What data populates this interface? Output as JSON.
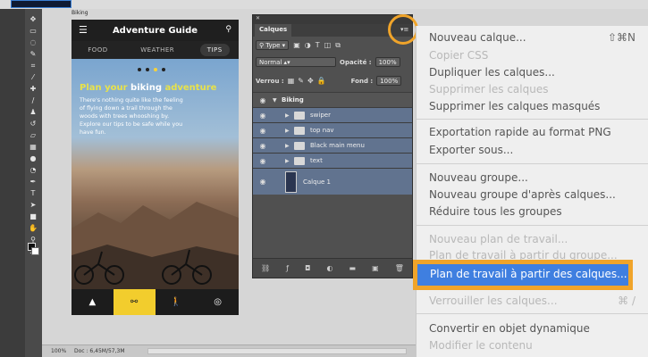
{
  "document": {
    "label": "Biking"
  },
  "app": {
    "title": "Adventure Guide",
    "tabs": [
      "FOOD",
      "WEATHER",
      "TIPS"
    ],
    "hero_title_accent": "Plan your ",
    "hero_title_mid": "biking",
    "hero_title_end": " adventure",
    "hero_body": "There's nothing quite like the feeling of flying down a trail through the woods with trees whooshing by. Explore our tips to be safe while you have fun."
  },
  "layers_panel": {
    "tab_label": "Calques",
    "filter": "Type",
    "blend_mode": "Normal",
    "opacity_label": "Opacité :",
    "opacity_value": "100%",
    "lock_label": "Verrou :",
    "fill_label": "Fond :",
    "fill_value": "100%",
    "items": [
      {
        "name": "Biking"
      },
      {
        "name": "swiper"
      },
      {
        "name": "top nav"
      },
      {
        "name": "Black main menu"
      },
      {
        "name": "text"
      },
      {
        "name": "Calque 1"
      }
    ]
  },
  "context_menu": {
    "items": [
      {
        "label": "Nouveau calque...",
        "shortcut": "⇧⌘N"
      },
      {
        "label": "Copier CSS"
      },
      {
        "label": "Dupliquer les calques..."
      },
      {
        "label": "Supprimer les calques"
      },
      {
        "label": "Supprimer les calques masqués"
      },
      {
        "label": "Exportation rapide au format PNG"
      },
      {
        "label": "Exporter sous..."
      },
      {
        "label": "Nouveau groupe..."
      },
      {
        "label": "Nouveau groupe d'après calques..."
      },
      {
        "label": "Réduire tous les groupes"
      },
      {
        "label": "Nouveau plan de travail..."
      },
      {
        "label": "Plan de travail à partir du groupe..."
      },
      {
        "label": "Plan de travail à partir des calques..."
      },
      {
        "label": "Verrouiller les calques...",
        "shortcut": "⌘ /"
      },
      {
        "label": "Convertir en objet dynamique"
      },
      {
        "label": "Modifier le contenu"
      }
    ]
  },
  "status": {
    "zoom": "100%",
    "doc": "Doc : 6,45M/57,3M"
  },
  "colors": {
    "accent_highlight": "#f0a42a",
    "menu_selection": "#3f7fe0",
    "app_yellow": "#f2cd2d"
  }
}
